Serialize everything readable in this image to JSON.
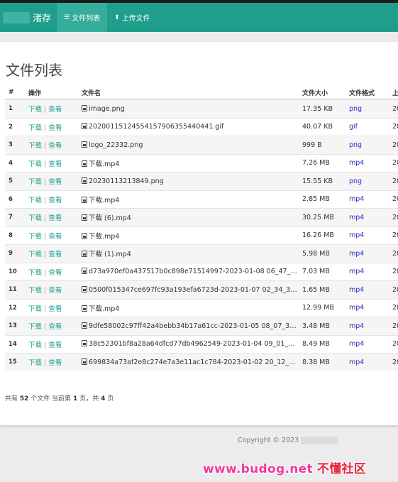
{
  "navbar": {
    "brand": "渚存",
    "items": [
      {
        "icon": "list-icon",
        "label": "文件列表",
        "active": true
      },
      {
        "icon": "upload-icon",
        "label": "上传文件",
        "active": false
      }
    ]
  },
  "page_title": "文件列表",
  "table": {
    "headers": [
      "#",
      "操作",
      "文件名",
      "文件大小",
      "文件格式",
      "上"
    ],
    "op_download": "下载",
    "op_view": "查看",
    "op_separator": "|",
    "rows": [
      {
        "idx": "1",
        "name": "image.png",
        "size": "17.35 KB",
        "format": "png",
        "tail": "20"
      },
      {
        "idx": "2",
        "name": "20200115124554157906355440441.gif",
        "size": "40.07 KB",
        "format": "gif",
        "tail": "20"
      },
      {
        "idx": "3",
        "name": "logo_22332.png",
        "size": "999 B",
        "format": "png",
        "tail": "20"
      },
      {
        "idx": "4",
        "name": "下载.mp4",
        "size": "7.26 MB",
        "format": "mp4",
        "tail": "20"
      },
      {
        "idx": "5",
        "name": "20230113213849.png",
        "size": "15.55 KB",
        "format": "png",
        "tail": "20"
      },
      {
        "idx": "6",
        "name": "下载.mp4",
        "size": "2.85 MB",
        "format": "mp4",
        "tail": "20"
      },
      {
        "idx": "7",
        "name": "下载 (6).mp4",
        "size": "30.25 MB",
        "format": "mp4",
        "tail": "20"
      },
      {
        "idx": "8",
        "name": "下载.mp4",
        "size": "16.26 MB",
        "format": "mp4",
        "tail": "20"
      },
      {
        "idx": "9",
        "name": "下载 (1).mp4",
        "size": "5.98 MB",
        "format": "mp4",
        "tail": "20"
      },
      {
        "idx": "10",
        "name": "d73a970ef0a437517b0c898e71514997-2023-01-08 06_47_26....",
        "size": "7.03 MB",
        "format": "mp4",
        "tail": "20"
      },
      {
        "idx": "11",
        "name": "0500f015347ce697fc93a193efa6723d-2023-01-07 02_34_32....",
        "size": "1.65 MB",
        "format": "mp4",
        "tail": "20"
      },
      {
        "idx": "12",
        "name": "下载.mp4",
        "size": "12.99 MB",
        "format": "mp4",
        "tail": "20"
      },
      {
        "idx": "13",
        "name": "9dfe58002c97ff42a4bebb34b17a61cc-2023-01-05 08_07_36....",
        "size": "3.48 MB",
        "format": "mp4",
        "tail": "20"
      },
      {
        "idx": "14",
        "name": "38c52301bf8a28a64dfcd77db4962549-2023-01-04 09_01_49....",
        "size": "8.49 MB",
        "format": "mp4",
        "tail": "20"
      },
      {
        "idx": "15",
        "name": "699834a73af2e8c274e7a3e11ac1c784-2023-01-02 20_12_16....",
        "size": "8.38 MB",
        "format": "mp4",
        "tail": "20"
      }
    ]
  },
  "summary": {
    "prefix": "共有",
    "total": "52",
    "mid1": "个文件 当前第",
    "page": "1",
    "mid2": "页，共",
    "pages": "4",
    "suffix": "页"
  },
  "footer": {
    "copyright": "Copyright © 2023"
  },
  "watermark": {
    "latin": "www.budog.net",
    "cn": "不懂社区"
  }
}
